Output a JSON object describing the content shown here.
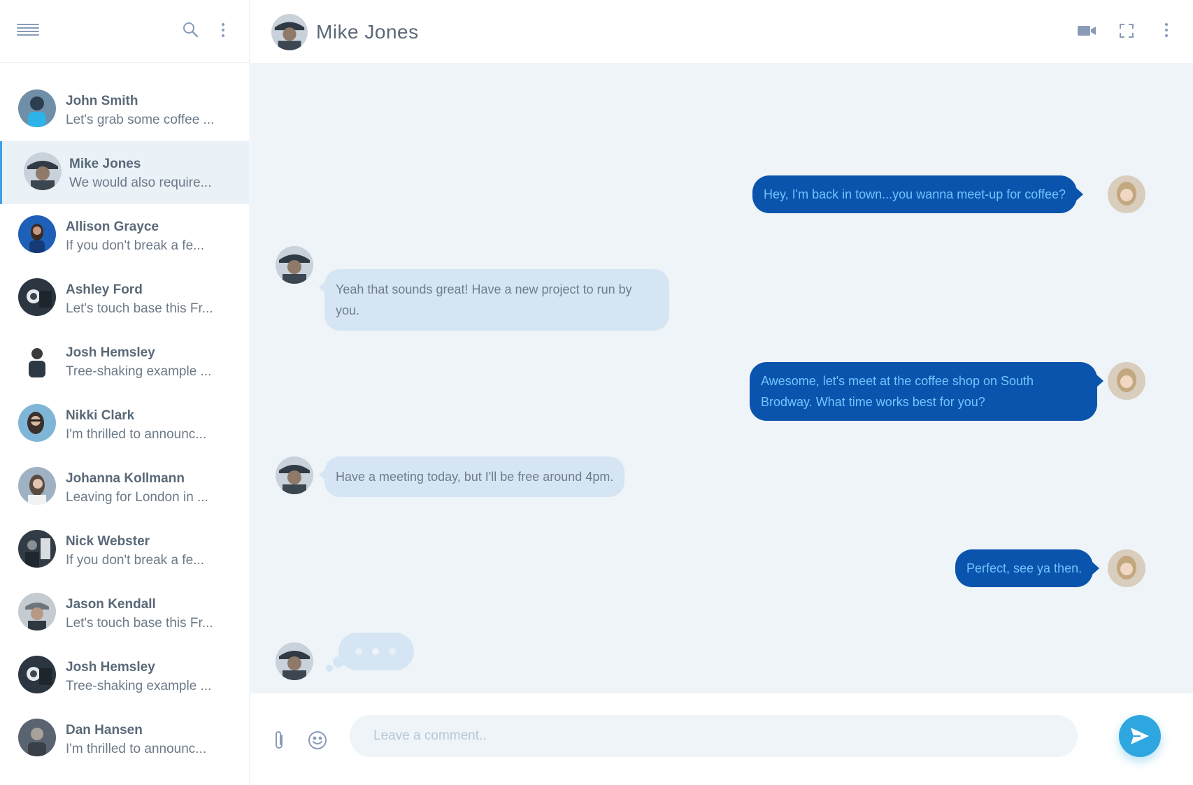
{
  "sidebar": {
    "contacts": [
      {
        "name": "John Smith",
        "preview": "Let's grab some coffee ..."
      },
      {
        "name": "Mike Jones",
        "preview": "We would also require..."
      },
      {
        "name": "Allison Grayce",
        "preview": "If you don't break a fe..."
      },
      {
        "name": "Ashley Ford",
        "preview": "Let's touch base this Fr..."
      },
      {
        "name": "Josh Hemsley",
        "preview": "Tree-shaking example ..."
      },
      {
        "name": "Nikki Clark",
        "preview": "I'm thrilled to announc..."
      },
      {
        "name": "Johanna Kollmann",
        "preview": "Leaving for London in ..."
      },
      {
        "name": "Nick Webster",
        "preview": "If you don't break a fe..."
      },
      {
        "name": "Jason Kendall",
        "preview": "Let's touch base this Fr..."
      },
      {
        "name": "Josh Hemsley",
        "preview": "Tree-shaking example ..."
      },
      {
        "name": "Dan Hansen",
        "preview": "I'm thrilled to announc..."
      }
    ],
    "active_contact": "Mike Jones"
  },
  "chat": {
    "title": "Mike Jones",
    "messages": [
      {
        "direction": "out",
        "text": "Hey, I'm back in town...you wanna meet-up for coffee?"
      },
      {
        "direction": "in",
        "lines": [
          "Yeah that sounds great! Have a new project to run by",
          "you."
        ]
      },
      {
        "direction": "out",
        "lines": [
          "Awesome, let's meet at the coffee shop on South",
          "Brodway. What time works best for you?"
        ]
      },
      {
        "direction": "in",
        "text": "Have a meeting today, but I'll be free around 4pm."
      },
      {
        "direction": "out",
        "text": "Perfect, see ya then."
      }
    ],
    "typing_indicator": true
  },
  "composer": {
    "placeholder": "Leave a comment.."
  },
  "icons": {
    "menu": "hamburger-icon",
    "search": "search-icon",
    "more": "kebab-icon",
    "video": "video-camera-icon",
    "fullscreen": "expand-icon",
    "attach": "paperclip-icon",
    "emoji": "smiley-icon",
    "send": "send-icon"
  },
  "colors": {
    "accent": "#2ea7e0",
    "outgoing_bubble": "#0b54ad",
    "outgoing_text": "#6fc5ff",
    "incoming_bubble": "#d6e5f4",
    "chat_background": "#eef4f8",
    "active_row": "#eaf1f7"
  }
}
